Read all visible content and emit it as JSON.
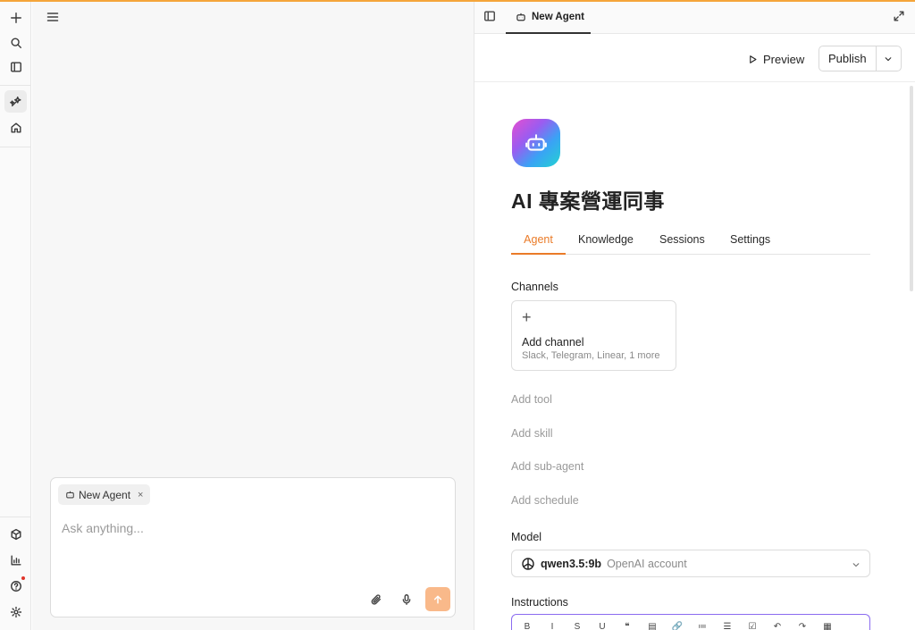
{
  "colors": {
    "accent": "#ea7b28",
    "top_line": "#f5a53a",
    "send": "#f9b98a",
    "editor_focus": "#8b6cf0"
  },
  "rail": {
    "items": [
      {
        "icon": "plus-icon"
      },
      {
        "icon": "search-icon"
      },
      {
        "icon": "sidebar-icon"
      },
      {
        "icon": "agent-sparkle-icon",
        "active": true
      },
      {
        "icon": "home-icon"
      }
    ],
    "bottom": [
      {
        "icon": "cube-icon"
      },
      {
        "icon": "bar-chart-icon"
      },
      {
        "icon": "help-icon",
        "notification": true
      },
      {
        "icon": "settings-icon"
      }
    ]
  },
  "chat": {
    "menu_icon": "hamburger-icon",
    "chip_label": "New Agent",
    "chip_close": "×",
    "input_placeholder": "Ask anything..."
  },
  "panel": {
    "tab_label": "New Agent",
    "toolbar": {
      "preview_label": "Preview",
      "publish_label": "Publish"
    },
    "agent_title": "AI 專案營運同事",
    "tabs": [
      {
        "label": "Agent",
        "active": true
      },
      {
        "label": "Knowledge"
      },
      {
        "label": "Sessions"
      },
      {
        "label": "Settings"
      }
    ],
    "channels": {
      "label": "Channels",
      "card_plus": "+",
      "card_title": "Add channel",
      "card_subtitle": "Slack, Telegram, Linear, 1 more"
    },
    "add_links": [
      "Add tool",
      "Add skill",
      "Add sub-agent",
      "Add schedule"
    ],
    "model": {
      "label": "Model",
      "name": "qwen3.5:9b",
      "account": "OpenAI account"
    },
    "instructions": {
      "label": "Instructions",
      "tools": [
        "B",
        "I",
        "S",
        "U",
        "❝",
        "▤",
        "🔗",
        "≔",
        "☰",
        "☑",
        "↶",
        "↷",
        "▦"
      ]
    }
  }
}
